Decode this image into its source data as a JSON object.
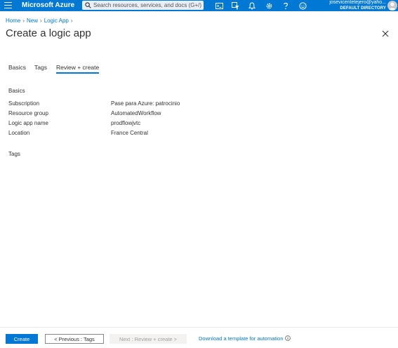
{
  "topbar": {
    "brand": "Microsoft Azure",
    "search_placeholder": "Search resources, services, and docs (G+/)",
    "user_email": "josevicentetejero@yaho...",
    "user_directory": "DEFAULT DIRECTORY",
    "color": "#0078d4"
  },
  "breadcrumb": [
    "Home",
    "New",
    "Logic App"
  ],
  "page": {
    "title": "Create a logic app"
  },
  "tabs": [
    "Basics",
    "Tags",
    "Review + create"
  ],
  "active_tab": "Review + create",
  "review": {
    "basics_heading": "Basics",
    "rows": [
      {
        "label": "Subscription",
        "value": "Pase para Azure: patrocinio"
      },
      {
        "label": "Resource group",
        "value": "AutomatedWorkflow"
      },
      {
        "label": "Logic app name",
        "value": "prodflowjvtc"
      },
      {
        "label": "Location",
        "value": "France Central"
      }
    ],
    "tags_heading": "Tags"
  },
  "footer": {
    "create_label": "Create",
    "previous_label": "< Previous : Tags",
    "next_label": "Next : Review + create >",
    "download_label": "Download a template for automation"
  },
  "icons": {
    "menu": "hamburger-menu-icon",
    "search": "search-icon",
    "cloud_shell": "cloud-shell-icon",
    "directory_filter": "directory-filter-icon",
    "notifications": "bell-icon",
    "settings": "gear-icon",
    "help": "question-icon",
    "feedback": "smiley-icon",
    "close": "close-icon",
    "info": "info-icon"
  }
}
